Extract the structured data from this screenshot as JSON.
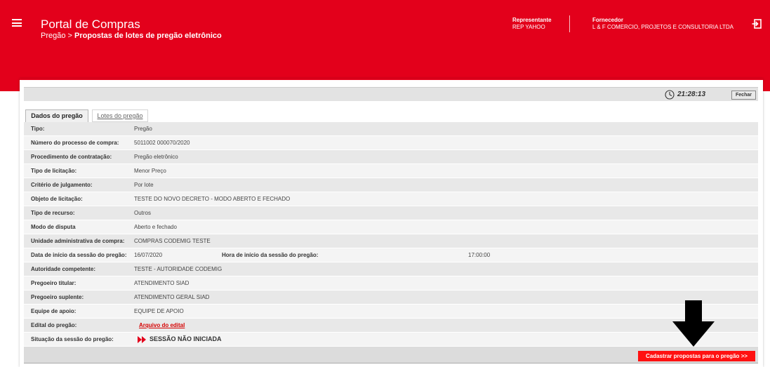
{
  "header": {
    "title": "Portal de Compras",
    "breadcrumb_root": "Pregão",
    "breadcrumb_separator": ">",
    "breadcrumb_current": "Propostas de lotes de pregão eletrônico",
    "rep_label": "Representante",
    "rep_value": "REP YAHOO",
    "forn_label": "Fornecedor",
    "forn_value": "L & F COMERCIO, PROJETOS E CONSULTORIA LTDA",
    "brand_color": "#e3001b"
  },
  "toolbar": {
    "time": "21:28:13",
    "close_label": "Fechar"
  },
  "tabs": [
    {
      "label": "Dados do pregão",
      "active": true
    },
    {
      "label": "Lotes do pregão",
      "active": false
    }
  ],
  "details": {
    "tipo": {
      "label": "Tipo:",
      "value": "Pregão"
    },
    "processo": {
      "label": "Número do processo de compra:",
      "value": "5011002 000070/2020"
    },
    "procedimento": {
      "label": "Procedimento de contratação:",
      "value": "Pregão eletrônico"
    },
    "tipo_licitacao": {
      "label": "Tipo de licitação:",
      "value": "Menor Preço"
    },
    "criterio": {
      "label": "Critério de julgamento:",
      "value": "Por lote"
    },
    "objeto": {
      "label": "Objeto de licitação:",
      "value": "TESTE DO NOVO DECRETO - MODO ABERTO E FECHADO"
    },
    "tipo_recurso": {
      "label": "Tipo de recurso:",
      "value": "Outros"
    },
    "modo_disputa": {
      "label": "Modo de disputa",
      "value": "Aberto e fechado"
    },
    "unidade": {
      "label": "Unidade administrativa de compra:",
      "value": "COMPRAS CODEMIG TESTE"
    },
    "data_inicio": {
      "label": "Data de início da sessão do pregão:",
      "value": "16/07/2020"
    },
    "hora_inicio": {
      "label": "Hora de início da sessão do pregão:",
      "value": "17:00:00"
    },
    "autoridade": {
      "label": "Autoridade competente:",
      "value": "TESTE - AUTORIDADE CODEMIG"
    },
    "pregoeiro_titular": {
      "label": "Pregoeiro titular:",
      "value": "ATENDIMENTO SIAD"
    },
    "pregoeiro_suplente": {
      "label": "Pregoeiro suplente:",
      "value": "ATENDIMENTO GERAL SIAD"
    },
    "equipe": {
      "label": "Equipe de apoio:",
      "value": "EQUIPE DE APOIO"
    },
    "edital": {
      "label": "Edital do pregão:",
      "value": "Arquivo do edital"
    },
    "situacao": {
      "label": "Situação da sessão do pregão:",
      "value": "SESSÃO NÃO INICIADA"
    }
  },
  "actions": {
    "submit_label": "Cadastrar propostas para o pregão >>"
  },
  "icons": {
    "menu": "hamburger-menu-icon",
    "exit": "exit-icon",
    "clock": "clock-icon",
    "status": "double-chevron-right-icon",
    "pointer": "down-arrow-icon"
  }
}
